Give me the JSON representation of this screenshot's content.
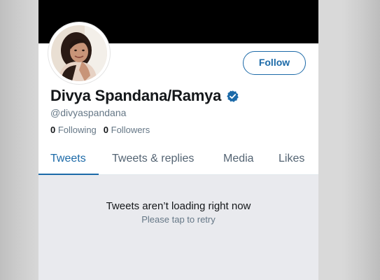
{
  "profile": {
    "display_name": "Divya Spandana/Ramya",
    "handle": "@divyaspandana",
    "verified": true,
    "following_count": "0",
    "following_label": "Following",
    "followers_count": "0",
    "followers_label": "Followers"
  },
  "actions": {
    "follow_label": "Follow"
  },
  "tabs": [
    {
      "label": "Tweets",
      "active": true
    },
    {
      "label": "Tweets & replies",
      "active": false
    },
    {
      "label": "Media",
      "active": false
    },
    {
      "label": "Likes",
      "active": false
    }
  ],
  "feed": {
    "error_title": "Tweets aren’t loading right now",
    "error_subtitle": "Please tap to retry"
  },
  "colors": {
    "accent": "#1c6aa8",
    "banner": "#000000",
    "secondary_text": "#657786"
  },
  "icons": {
    "verified": "verified-badge-icon",
    "avatar": "profile-photo"
  }
}
